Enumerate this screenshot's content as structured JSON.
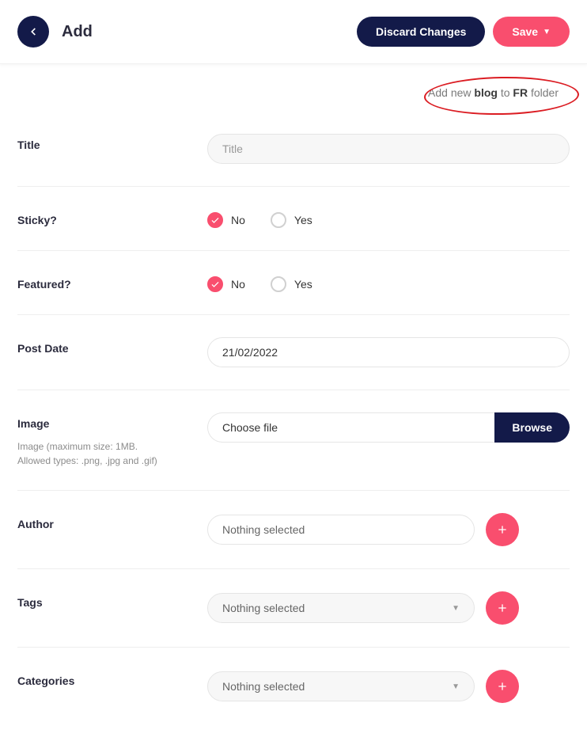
{
  "header": {
    "title": "Add",
    "discard_label": "Discard Changes",
    "save_label": "Save"
  },
  "hint": {
    "prefix": "Add new ",
    "type": "blog",
    "mid": " to ",
    "folder": "FR",
    "suffix": " folder"
  },
  "fields": {
    "title": {
      "label": "Title",
      "placeholder": "Title",
      "value": ""
    },
    "sticky": {
      "label": "Sticky?",
      "options": {
        "no": "No",
        "yes": "Yes"
      },
      "value": "no"
    },
    "featured": {
      "label": "Featured?",
      "options": {
        "no": "No",
        "yes": "Yes"
      },
      "value": "no"
    },
    "post_date": {
      "label": "Post Date",
      "value": "21/02/2022"
    },
    "image": {
      "label": "Image",
      "helper": "Image (maximum size: 1MB. Allowed types: .png, .jpg and .gif)",
      "choose_text": "Choose file",
      "browse_label": "Browse"
    },
    "author": {
      "label": "Author",
      "placeholder": "Nothing selected"
    },
    "tags": {
      "label": "Tags",
      "placeholder": "Nothing selected"
    },
    "categories": {
      "label": "Categories",
      "placeholder": "Nothing selected"
    }
  }
}
